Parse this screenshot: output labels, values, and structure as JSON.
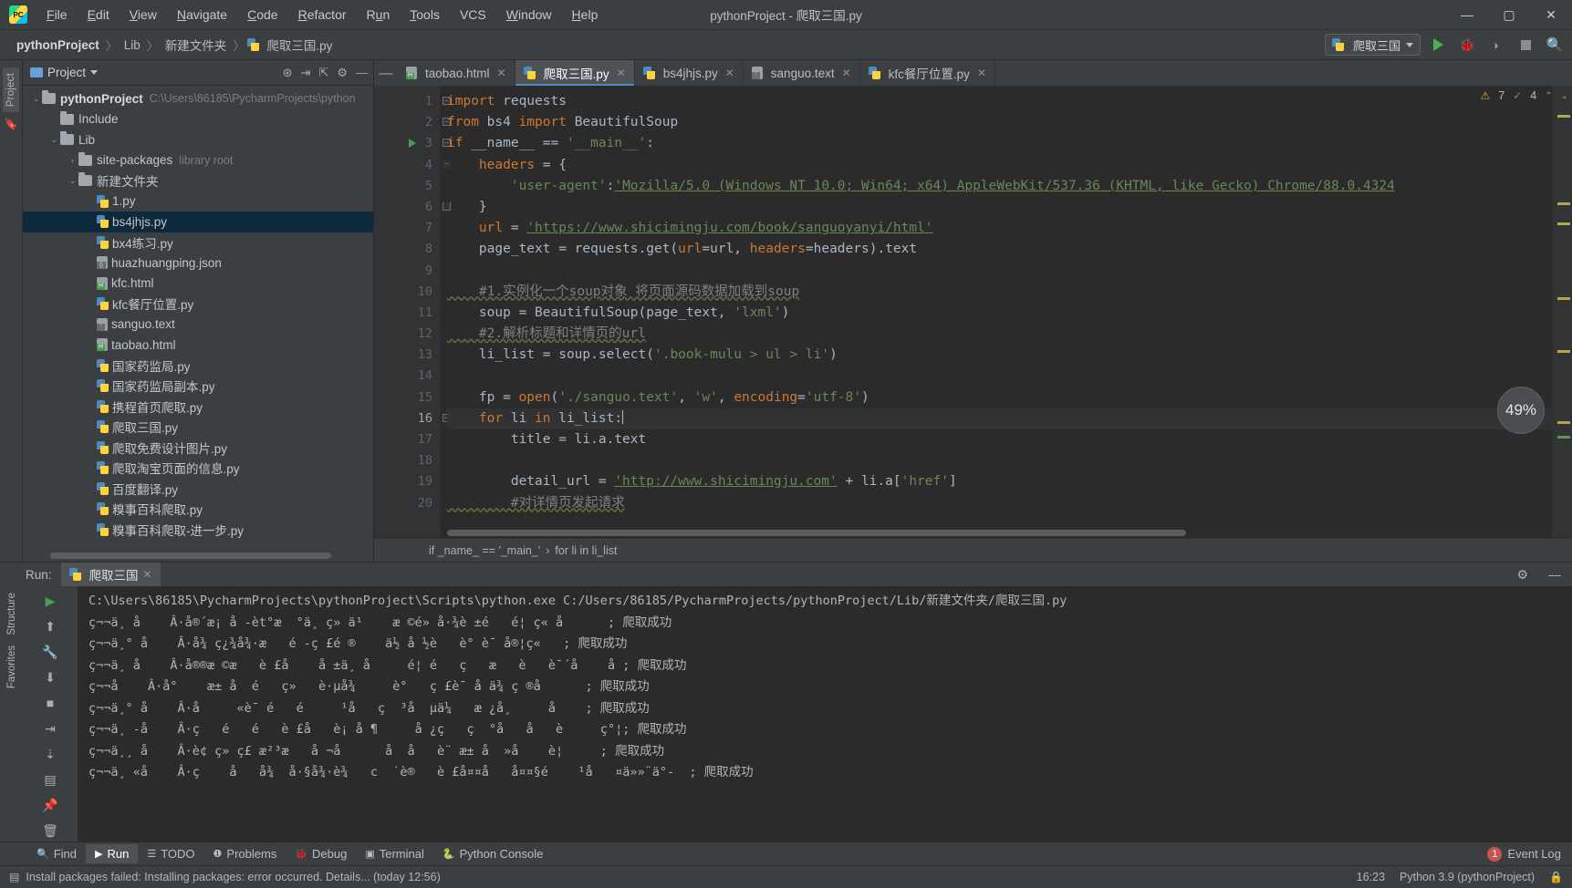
{
  "window": {
    "title": "pythonProject - 爬取三国.py",
    "minimize": "—",
    "maximize": "▢",
    "close": "✕"
  },
  "menu": [
    "File",
    "Edit",
    "View",
    "Navigate",
    "Code",
    "Refactor",
    "Run",
    "Tools",
    "VCS",
    "Window",
    "Help"
  ],
  "breadcrumb": {
    "items": [
      "pythonProject",
      "Lib",
      "新建文件夹",
      "爬取三国.py"
    ],
    "separator": "〉"
  },
  "run_config": {
    "name": "爬取三国",
    "run_tooltip": "Run",
    "debug_tooltip": "Debug",
    "coverage_tooltip": "Run with Coverage",
    "stop_tooltip": "Stop",
    "search_tooltip": "Search Everywhere"
  },
  "left_strip": {
    "project_tab": "Project",
    "structure_tab": "Structure",
    "favorites_tab": "Favorites"
  },
  "project_panel": {
    "title": "Project",
    "tools": [
      "⊛",
      "⇥",
      "⇱",
      "⚙",
      "—"
    ],
    "tree": [
      {
        "depth": 0,
        "arrow": "⌄",
        "icon": "folder",
        "label": "pythonProject",
        "bold": true,
        "sub": "C:\\Users\\86185\\PycharmProjects\\python",
        "selected": false
      },
      {
        "depth": 1,
        "arrow": "",
        "icon": "folder",
        "label": "Include",
        "bold": false,
        "sub": "",
        "selected": false
      },
      {
        "depth": 1,
        "arrow": "⌄",
        "icon": "folder",
        "label": "Lib",
        "bold": false,
        "sub": "",
        "selected": false
      },
      {
        "depth": 2,
        "arrow": "›",
        "icon": "folder",
        "label": "site-packages",
        "bold": false,
        "sub": "library root",
        "selected": false
      },
      {
        "depth": 2,
        "arrow": "⌄",
        "icon": "folder",
        "label": "新建文件夹",
        "bold": false,
        "sub": "",
        "selected": false
      },
      {
        "depth": 3,
        "arrow": "",
        "icon": "py",
        "label": "1.py",
        "bold": false,
        "sub": "",
        "selected": false
      },
      {
        "depth": 3,
        "arrow": "",
        "icon": "py",
        "label": "bs4jhjs.py",
        "bold": false,
        "sub": "",
        "selected": true
      },
      {
        "depth": 3,
        "arrow": "",
        "icon": "py",
        "label": "bx4练习.py",
        "bold": false,
        "sub": "",
        "selected": false
      },
      {
        "depth": 3,
        "arrow": "",
        "icon": "json",
        "label": "huazhuangping.json",
        "bold": false,
        "sub": "",
        "selected": false
      },
      {
        "depth": 3,
        "arrow": "",
        "icon": "html",
        "label": "kfc.html",
        "bold": false,
        "sub": "",
        "selected": false
      },
      {
        "depth": 3,
        "arrow": "",
        "icon": "py",
        "label": "kfc餐厅位置.py",
        "bold": false,
        "sub": "",
        "selected": false
      },
      {
        "depth": 3,
        "arrow": "",
        "icon": "text",
        "label": "sanguo.text",
        "bold": false,
        "sub": "",
        "selected": false
      },
      {
        "depth": 3,
        "arrow": "",
        "icon": "html",
        "label": "taobao.html",
        "bold": false,
        "sub": "",
        "selected": false
      },
      {
        "depth": 3,
        "arrow": "",
        "icon": "py",
        "label": "国家药监局.py",
        "bold": false,
        "sub": "",
        "selected": false
      },
      {
        "depth": 3,
        "arrow": "",
        "icon": "py",
        "label": "国家药监局副本.py",
        "bold": false,
        "sub": "",
        "selected": false
      },
      {
        "depth": 3,
        "arrow": "",
        "icon": "py",
        "label": "携程首页爬取.py",
        "bold": false,
        "sub": "",
        "selected": false
      },
      {
        "depth": 3,
        "arrow": "",
        "icon": "py",
        "label": "爬取三国.py",
        "bold": false,
        "sub": "",
        "selected": false
      },
      {
        "depth": 3,
        "arrow": "",
        "icon": "py",
        "label": "爬取免费设计图片.py",
        "bold": false,
        "sub": "",
        "selected": false
      },
      {
        "depth": 3,
        "arrow": "",
        "icon": "py",
        "label": "爬取淘宝页面的信息.py",
        "bold": false,
        "sub": "",
        "selected": false
      },
      {
        "depth": 3,
        "arrow": "",
        "icon": "py",
        "label": "百度翻译.py",
        "bold": false,
        "sub": "",
        "selected": false
      },
      {
        "depth": 3,
        "arrow": "",
        "icon": "py",
        "label": "糗事百科爬取.py",
        "bold": false,
        "sub": "",
        "selected": false
      },
      {
        "depth": 3,
        "arrow": "",
        "icon": "py",
        "label": "糗事百科爬取-进一步.py",
        "bold": false,
        "sub": "",
        "selected": false
      }
    ]
  },
  "editor_tabs": [
    {
      "label": "taobao.html",
      "icon": "html",
      "active": false
    },
    {
      "label": "爬取三国.py",
      "icon": "py",
      "active": true
    },
    {
      "label": "bs4jhjs.py",
      "icon": "py",
      "active": false
    },
    {
      "label": "sanguo.text",
      "icon": "text",
      "active": false
    },
    {
      "label": "kfc餐厅位置.py",
      "icon": "py",
      "active": false
    }
  ],
  "editor": {
    "warn_count": "7",
    "ok_count": "4",
    "zoom_level": "49%",
    "current_line": 16,
    "line_numbers": [
      "1",
      "2",
      "3",
      "4",
      "5",
      "6",
      "7",
      "8",
      "9",
      "10",
      "11",
      "12",
      "13",
      "14",
      "15",
      "16",
      "17",
      "18",
      "19",
      "20"
    ],
    "code_lines": [
      "import requests",
      "from bs4 import BeautifulSoup",
      "if __name__ == '__main__':",
      "    headers = {",
      "        'user-agent':'Mozilla/5.0 (Windows NT 10.0; Win64; x64) AppleWebKit/537.36 (KHTML, like Gecko) Chrome/88.0.4324",
      "    }",
      "    url = 'https://www.shicimingju.com/book/sanguoyanyi/html'",
      "    page_text = requests.get(url=url, headers=headers).text",
      "",
      "    #1.实例化一个soup对象 将页面源码数据加载到soup",
      "    soup = BeautifulSoup(page_text, 'lxml')",
      "    #2.解析标题和详情页的url",
      "    li_list = soup.select('.book-mulu > ul > li')",
      "",
      "    fp = open('./sanguo.text', 'w', encoding='utf-8')",
      "    for li in li_list:",
      "        title = li.a.text",
      "",
      "        detail_url = 'http://www.shicimingju.com' + li.a['href']",
      "        #对详情页发起请求"
    ]
  },
  "editor_breadcrumb": {
    "items": [
      "if _name_ == '_main_'",
      "for li in li_list"
    ],
    "separator": "›"
  },
  "run_panel": {
    "label": "Run:",
    "tab_name": "爬取三国",
    "close": "✕",
    "settings_icon": "⚙",
    "gutter_buttons": [
      "▶",
      "⬆",
      "⬇",
      "🔧",
      "■",
      "⇥",
      "⇣",
      "▤",
      "🖨",
      "📌",
      "🗑"
    ],
    "console_lines": [
      "C:\\Users\\86185\\PycharmProjects\\pythonProject\\Scripts\\python.exe C:/Users/86185/PycharmProjects/pythonProject/Lib/新建文件夹/爬取三国.py",
      "ç¬¬ä¸ å    Â·å®´æ¡ å -èt°æ  °ä¸ ç» ä¹    æ ©é» å·¾è ±é   é¦ ç« å      ; 爬取成功",
      "ç¬¬ä¸° å    Â·å¾ ç¿¾å¾·æ   é -ç £é ®    ä½ å ½è   è° è¯ å®¦ç«   ; 爬取成功",
      "ç¬¬ä¸ å    Â·å®®æ ©æ   è £å    å ±ä¸ å     é¦ é   ç   æ   è   è¯´å    å ; 爬取成功",
      "ç¬¬å    Â·å°    æ± å  é   ç»   è·µå¾     è°   ç £è¯ å­ ä¾ ç ®å      ; 爬取成功",
      "ç¬¬ä¸° å    Â·å     «è¯ é   é     ¹å   ç  ³å  µä¼   æ ¿å¸     å    ; 爬取成功",
      "ç¬¬ä¸ -å    Â·ç   é   é   è £å   è¡ å ¶     å ¿ç   ç  °å­   å   è     ç°¦; 爬取成功",
      "ç¬¬ä¸¸ å    Â·è¢ ç» ç£ æ²³æ   å ¬å­      å­  å   è¨ æ± å  »å    è¦     ; 爬取成功",
      "ç¬¬ä¸ «å    Â·ç    å   å¾  å·§å¾·è¾   c  ˙è®   è £å¤¤å   å¤¤§é    ¹å   ¤ä»»¨ä°-  ; 爬取成功"
    ]
  },
  "bottom_bar": {
    "items": [
      {
        "icon": "🔍",
        "label": "Find",
        "selected": false
      },
      {
        "icon": "▶",
        "label": "Run",
        "selected": true
      },
      {
        "icon": "☰",
        "label": "TODO",
        "selected": false
      },
      {
        "icon": "❶",
        "label": "Problems",
        "selected": false
      },
      {
        "icon": "🐞",
        "label": "Debug",
        "selected": false
      },
      {
        "icon": "▣",
        "label": "Terminal",
        "selected": false
      },
      {
        "icon": "🐍",
        "label": "Python Console",
        "selected": false
      }
    ],
    "event_log": {
      "count": "1",
      "label": "Event Log"
    }
  },
  "status_bar": {
    "message": "Install packages failed: Installing packages: error occurred. Details... (today 12:56)",
    "time": "16:23",
    "interpreter": "Python 3.9 (pythonProject)",
    "lock_icon": "🔒"
  }
}
